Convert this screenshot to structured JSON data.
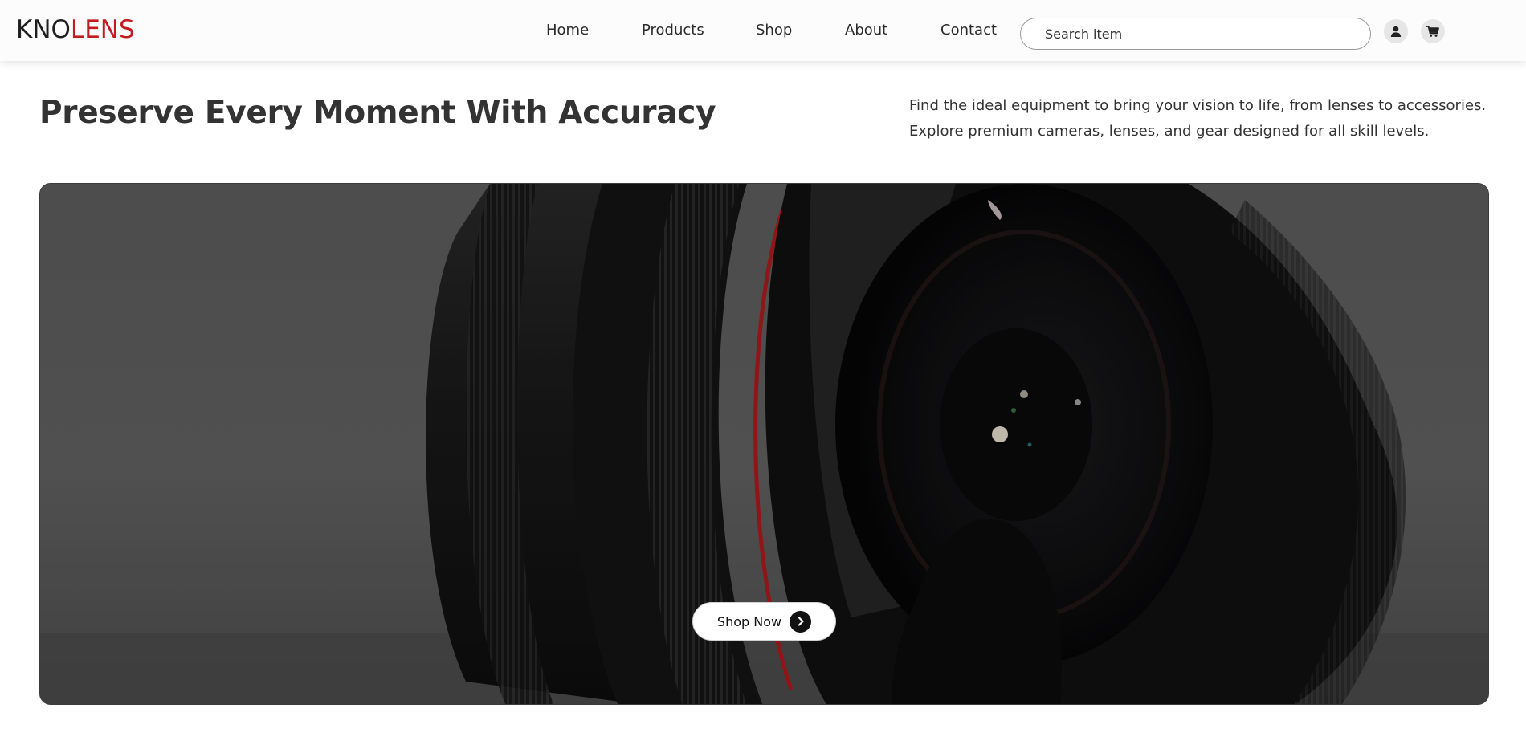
{
  "brand": {
    "part1": "KNO",
    "part2": "LENS",
    "accent_color": "#c41a1f"
  },
  "nav": {
    "items": [
      {
        "label": "Home"
      },
      {
        "label": "Products"
      },
      {
        "label": "Shop"
      },
      {
        "label": "About"
      },
      {
        "label": "Contact"
      }
    ]
  },
  "search": {
    "placeholder": "Search item",
    "value": ""
  },
  "header_icons": {
    "account": "user-icon",
    "cart": "shopping-cart-icon"
  },
  "intro": {
    "headline": "Preserve Every Moment With Accuracy",
    "tagline_line1": "Find the ideal equipment to bring your vision to life, from lenses to accessories.",
    "tagline_line2": "Explore premium cameras, lenses, and gear designed for all skill levels."
  },
  "hero": {
    "image": "camera-lens-photo",
    "button_label": "Shop Now",
    "button_icon": "chevron-right-icon"
  }
}
